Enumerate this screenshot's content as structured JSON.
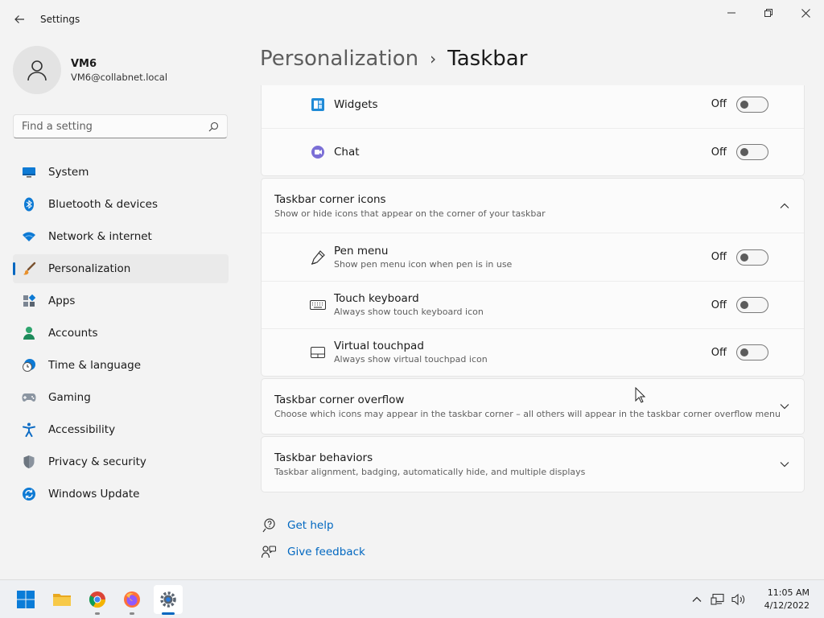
{
  "window": {
    "app_title": "Settings",
    "back_icon": "arrow-left-icon",
    "controls": [
      "minimize-icon",
      "restore-icon",
      "close-icon"
    ]
  },
  "profile": {
    "name": "VM6",
    "email": "VM6@collabnet.local"
  },
  "search": {
    "placeholder": "Find a setting",
    "value": ""
  },
  "nav": {
    "items": [
      {
        "label": "System",
        "icon": "monitor-icon",
        "active": false
      },
      {
        "label": "Bluetooth & devices",
        "icon": "bluetooth-icon",
        "active": false
      },
      {
        "label": "Network & internet",
        "icon": "wifi-icon",
        "active": false
      },
      {
        "label": "Personalization",
        "icon": "paintbrush-icon",
        "active": true
      },
      {
        "label": "Apps",
        "icon": "apps-icon",
        "active": false
      },
      {
        "label": "Accounts",
        "icon": "person-icon",
        "active": false
      },
      {
        "label": "Time & language",
        "icon": "clock-globe-icon",
        "active": false
      },
      {
        "label": "Gaming",
        "icon": "gamepad-icon",
        "active": false
      },
      {
        "label": "Accessibility",
        "icon": "accessibility-icon",
        "active": false
      },
      {
        "label": "Privacy & security",
        "icon": "shield-icon",
        "active": false
      },
      {
        "label": "Windows Update",
        "icon": "update-icon",
        "active": false
      }
    ]
  },
  "breadcrumb": {
    "parent": "Personalization",
    "separator": "›",
    "current": "Taskbar"
  },
  "taskbar_items": {
    "widgets": {
      "label": "Widgets",
      "state": "Off"
    },
    "chat": {
      "label": "Chat",
      "state": "Off"
    }
  },
  "corner_icons": {
    "title": "Taskbar corner icons",
    "subtitle": "Show or hide icons that appear on the corner of your taskbar",
    "items": [
      {
        "label": "Pen menu",
        "sub": "Show pen menu icon when pen is in use",
        "state": "Off"
      },
      {
        "label": "Touch keyboard",
        "sub": "Always show touch keyboard icon",
        "state": "Off"
      },
      {
        "label": "Virtual touchpad",
        "sub": "Always show virtual touchpad icon",
        "state": "Off"
      }
    ]
  },
  "corner_overflow": {
    "title": "Taskbar corner overflow",
    "subtitle": "Choose which icons may appear in the taskbar corner – all others will appear in the taskbar corner overflow menu"
  },
  "behaviors": {
    "title": "Taskbar behaviors",
    "subtitle": "Taskbar alignment, badging, automatically hide, and multiple displays"
  },
  "help": {
    "get_help": "Get help",
    "give_feedback": "Give feedback"
  },
  "system_taskbar": {
    "apps": [
      "start-icon",
      "file-explorer-icon",
      "chrome-icon",
      "firefox-icon",
      "settings-icon"
    ],
    "time": "11:05 AM",
    "date": "4/12/2022"
  },
  "colors": {
    "accent": "#0067c0",
    "background": "#f3f3f3",
    "card": "#fbfbfb"
  }
}
